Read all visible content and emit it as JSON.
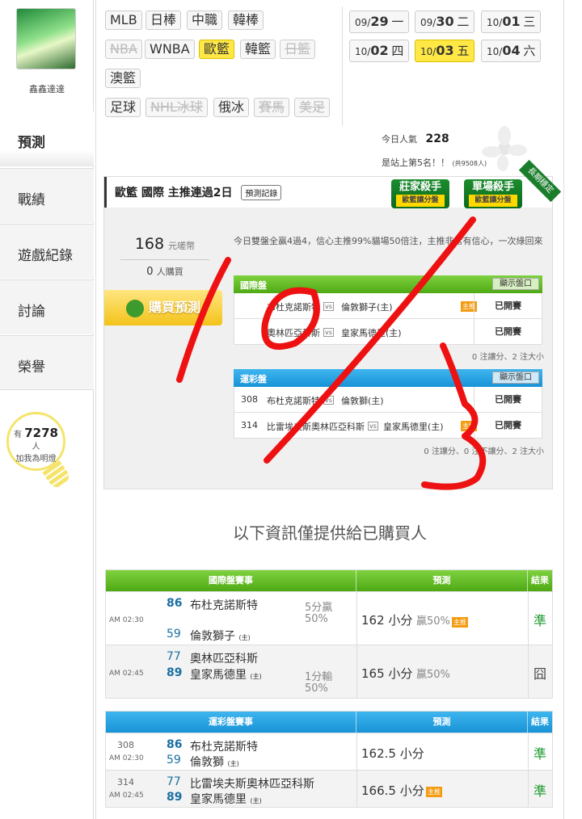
{
  "user": {
    "name": "鑫鑫達達"
  },
  "nav": [
    {
      "label": "預測"
    },
    {
      "label": "戰績"
    },
    {
      "label": "遊戲紀錄"
    },
    {
      "label": "討論"
    },
    {
      "label": "榮譽"
    }
  ],
  "fans": {
    "prefix": "有",
    "count": "7278",
    "suffix": "人",
    "caption": "加我為明燈"
  },
  "leagues": [
    "MLB",
    "日棒",
    "中職",
    "韓棒",
    "NBA",
    "WNBA",
    "歐籃",
    "韓籃",
    "日籃",
    "澳籃",
    "足球",
    "NHL冰球",
    "俄冰",
    "賽馬",
    "美足"
  ],
  "dates": [
    {
      "md": "09/",
      "d": "29",
      "w": "一"
    },
    {
      "md": "09/",
      "d": "30",
      "w": "二"
    },
    {
      "md": "10/",
      "d": "01",
      "w": "三"
    },
    {
      "md": "10/",
      "d": "02",
      "w": "四"
    },
    {
      "md": "10/",
      "d": "03",
      "w": "五"
    },
    {
      "md": "10/",
      "d": "04",
      "w": "六"
    }
  ],
  "popularity": {
    "label": "今日人氣",
    "value": "228",
    "rank": "是站上第5名！！",
    "total": "(共9508人)"
  },
  "card": {
    "title": "歐籃 國際 主推連過2日",
    "record_btn": "預測記錄",
    "badge1": {
      "t": "莊家殺手",
      "s": "歐籃讓分盤"
    },
    "badge2": {
      "t": "單場殺手",
      "s": "歐籃讓分盤"
    },
    "ribbon": "長期穩定",
    "price": "168",
    "price_unit": "元嗟幣",
    "buyers": "0",
    "buyers_unit": "人購買",
    "buy_btn": "購買預測",
    "desc": "今日雙盤全贏4過4，信心主推99%貓場50倍注，主推非常有信心，一次綠回來",
    "intl": {
      "title": "國際盤",
      "show": "顯示盤口",
      "rows": [
        {
          "a": "布杜克諾斯特",
          "b": "倫敦獅子(主)",
          "status": "已開賽",
          "rate": "主推"
        },
        {
          "a": "奧林匹亞科斯",
          "b": "皇家馬德里(主)",
          "status": "已開賽"
        }
      ],
      "foot": "0 注讓分、2 注大小"
    },
    "lottery": {
      "title": "運彩盤",
      "show": "顯示盤口",
      "rows": [
        {
          "no": "308",
          "a": "布杜克諾斯特",
          "b": "倫敦獅(主)",
          "status": "已開賽"
        },
        {
          "no": "314",
          "a": "比雷埃夫斯奧林匹亞科斯",
          "b": "皇家馬德里(主)",
          "status": "已開賽",
          "rate": "主推"
        }
      ],
      "foot": "0 注讓分、0 注不讓分、2 注大小"
    }
  },
  "notice": "以下資訊僅提供給已購買人",
  "intl_table": {
    "headers": [
      "國際盤賽事",
      "預測",
      "結果"
    ],
    "rows": [
      {
        "time": "AM 02:30",
        "s1": "86",
        "t1": "布杜克諾斯特",
        "s2": "59",
        "t2": "倫敦獅子",
        "home": "(主)",
        "spread1": "5分贏",
        "spread2": "50%",
        "pick": "162 小分",
        "win": "贏50%",
        "rate": "主推",
        "result": "準"
      },
      {
        "time": "AM 02:45",
        "s1": "77",
        "t1": "奧林匹亞科斯",
        "s2": "89",
        "t2": "皇家馬德里",
        "home": "(主)",
        "spread1": "1分輸",
        "spread2": "50%",
        "pick": "165 小分",
        "win": "贏50%",
        "result": "囧"
      }
    ]
  },
  "lot_table": {
    "headers": [
      "運彩盤賽事",
      "預測",
      "結果"
    ],
    "rows": [
      {
        "no": "308",
        "time": "AM 02:30",
        "s1": "86",
        "t1": "布杜克諾斯特",
        "s2": "59",
        "t2": "倫敦獅",
        "home": "(主)",
        "pick": "162.5 小分",
        "result": "準"
      },
      {
        "no": "314",
        "time": "AM 02:45",
        "s1": "77",
        "t1": "比雷埃夫斯奧林匹亞科斯",
        "s2": "89",
        "t2": "皇家馬德里",
        "home": "(主)",
        "pick": "166.5 小分",
        "rate": "主推",
        "result": "準"
      }
    ]
  },
  "colors": {
    "highlight": "#ffe845",
    "green": "#5cb91f",
    "blue": "#1fa2e4",
    "annotation": "#ee1111"
  }
}
